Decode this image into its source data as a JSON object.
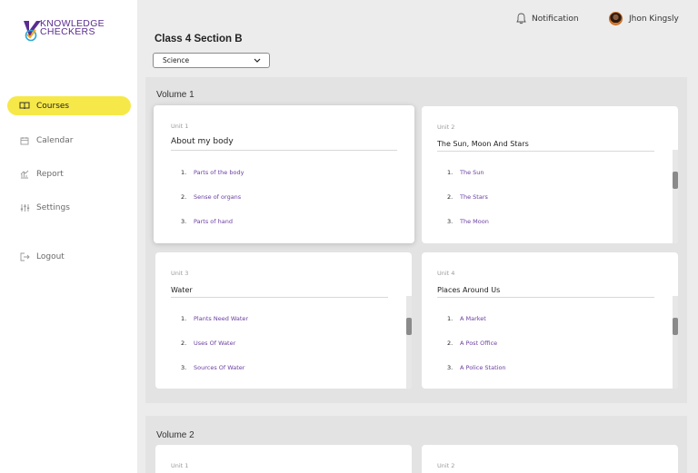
{
  "brand": {
    "line1": "KNOWLEDGE",
    "line2": "CHECKERS"
  },
  "sidebar": {
    "items": [
      {
        "label": "Courses",
        "icon": "book-icon",
        "active": true
      },
      {
        "label": "Calendar",
        "icon": "calendar-icon",
        "active": false
      },
      {
        "label": "Report",
        "icon": "report-icon",
        "active": false
      },
      {
        "label": "Settings",
        "icon": "settings-sliders-icon",
        "active": false
      },
      {
        "label": "Logout",
        "icon": "logout-icon",
        "active": false
      }
    ]
  },
  "header": {
    "notification_label": "Notification",
    "user_name": "Jhon Kingsly"
  },
  "page": {
    "title": "Class 4 Section B",
    "subject": "Science"
  },
  "volumes": [
    {
      "title": "Volume 1",
      "units": [
        {
          "unit_label": "Unit 1",
          "title": "About my body",
          "topics": [
            {
              "num": "1.",
              "label": "Parts of the body"
            },
            {
              "num": "2.",
              "label": "Sense of organs"
            },
            {
              "num": "3.",
              "label": "Parts of hand"
            }
          ]
        },
        {
          "unit_label": "Unit 2",
          "title": "The Sun, Moon And Stars",
          "topics": [
            {
              "num": "1.",
              "label": "The Sun"
            },
            {
              "num": "2.",
              "label": "The Stars"
            },
            {
              "num": "3.",
              "label": "The Moon"
            }
          ]
        },
        {
          "unit_label": "Unit 3",
          "title": "Water",
          "topics": [
            {
              "num": "1.",
              "label": "Plants Need Water"
            },
            {
              "num": "2.",
              "label": "Uses Of Water"
            },
            {
              "num": "3.",
              "label": "Sources Of Water"
            }
          ]
        },
        {
          "unit_label": "Unit 4",
          "title": "Places Around Us",
          "topics": [
            {
              "num": "1.",
              "label": "A Market"
            },
            {
              "num": "2.",
              "label": "A Post Office"
            },
            {
              "num": "3.",
              "label": "A Police Station"
            }
          ]
        }
      ]
    },
    {
      "title": "Volume 2",
      "units": [
        {
          "unit_label": "Unit 1"
        },
        {
          "unit_label": "Unit 2"
        }
      ]
    }
  ],
  "colors": {
    "accent": "#f7e84a",
    "topic_link": "#6b3fa0",
    "brand_purple": "#5a2d91"
  }
}
